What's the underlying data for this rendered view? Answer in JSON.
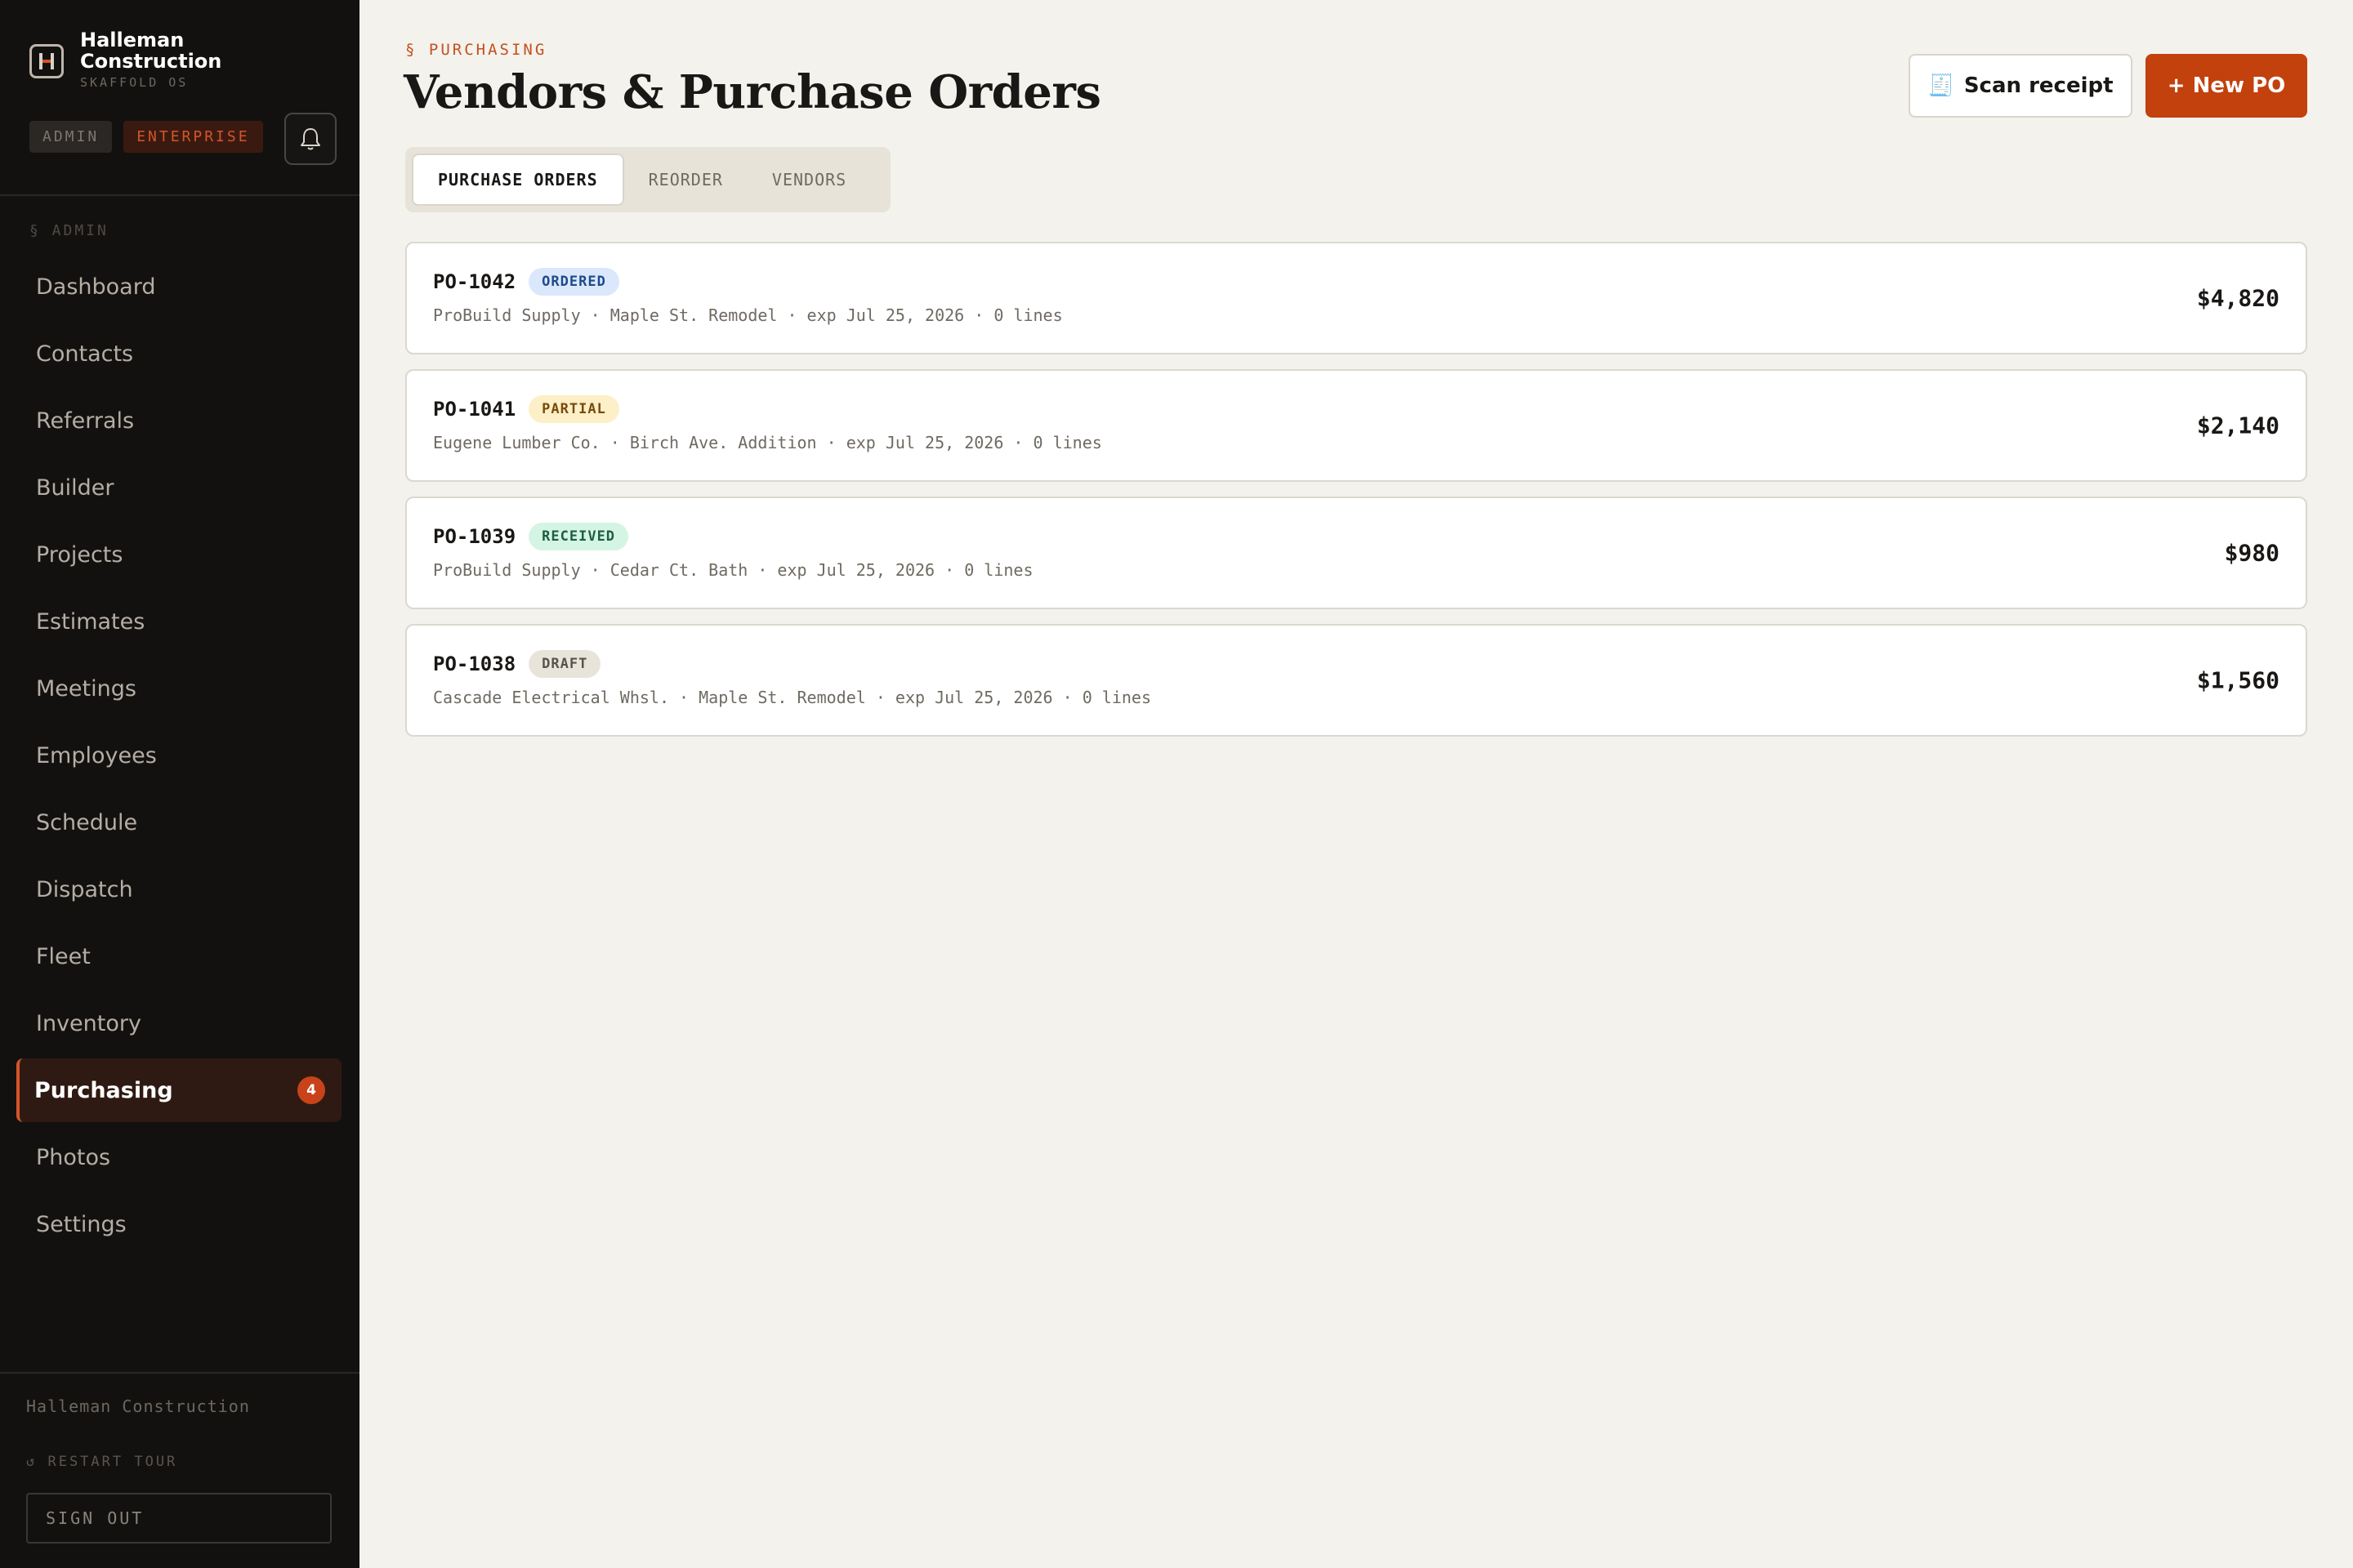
{
  "brand": {
    "name": "Halleman Construction",
    "subtitle": "SKAFFOLD OS",
    "logo_icon": "h-beam-logo-icon"
  },
  "roles": {
    "admin": "ADMIN",
    "plan": "ENTERPRISE"
  },
  "nav": {
    "section_label": "§ ADMIN",
    "items": [
      {
        "label": "Dashboard"
      },
      {
        "label": "Contacts"
      },
      {
        "label": "Referrals"
      },
      {
        "label": "Builder"
      },
      {
        "label": "Projects"
      },
      {
        "label": "Estimates"
      },
      {
        "label": "Meetings"
      },
      {
        "label": "Employees"
      },
      {
        "label": "Schedule"
      },
      {
        "label": "Dispatch"
      },
      {
        "label": "Fleet"
      },
      {
        "label": "Inventory"
      },
      {
        "label": "Purchasing",
        "badge": "4",
        "active": true
      },
      {
        "label": "Photos"
      },
      {
        "label": "Settings"
      }
    ]
  },
  "footer": {
    "org": "Halleman Construction",
    "restart_tour": "↺ RESTART TOUR",
    "sign_out": "SIGN OUT"
  },
  "header": {
    "eyebrow": "§ PURCHASING",
    "title": "Vendors & Purchase Orders",
    "scan_icon": "🧾",
    "scan_label": "Scan receipt",
    "new_po_label": "+ New PO"
  },
  "tabs": [
    {
      "label": "PURCHASE ORDERS",
      "active": true
    },
    {
      "label": "REORDER",
      "active": false
    },
    {
      "label": "VENDORS",
      "active": false
    }
  ],
  "purchase_orders": [
    {
      "id": "PO-1042",
      "status": "ORDERED",
      "meta": "ProBuild Supply · Maple St. Remodel · exp Jul 25, 2026 · 0 lines",
      "amount": "$4,820"
    },
    {
      "id": "PO-1041",
      "status": "PARTIAL",
      "meta": "Eugene Lumber Co. · Birch Ave. Addition · exp Jul 25, 2026 · 0 lines",
      "amount": "$2,140"
    },
    {
      "id": "PO-1039",
      "status": "RECEIVED",
      "meta": "ProBuild Supply · Cedar Ct. Bath · exp Jul 25, 2026 · 0 lines",
      "amount": "$980"
    },
    {
      "id": "PO-1038",
      "status": "DRAFT",
      "meta": "Cascade Electrical Whsl. · Maple St. Remodel · exp Jul 25, 2026 · 0 lines",
      "amount": "$1,560"
    }
  ],
  "status_colors": {
    "ORDERED": {
      "bg": "#dbe8fb",
      "fg": "#1e4a8c"
    },
    "PARTIAL": {
      "bg": "#fdefc7",
      "fg": "#7a4a0c"
    },
    "RECEIVED": {
      "bg": "#d4f5e3",
      "fg": "#1f5e3e"
    },
    "DRAFT": {
      "bg": "#e8e4da",
      "fg": "#58534b"
    }
  },
  "colors": {
    "accent": "#c2410c",
    "sidebar_bg": "#131110",
    "page_bg": "#f4f2ed"
  }
}
